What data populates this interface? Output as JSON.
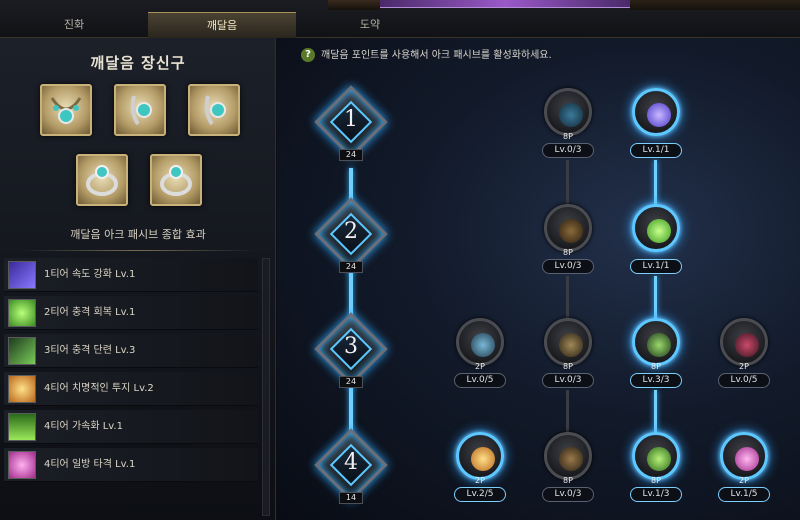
{
  "tabs": [
    {
      "label": "진화"
    },
    {
      "label": "깨달음"
    },
    {
      "label": "도약"
    }
  ],
  "left": {
    "title": "깨달음 장신구",
    "summary_title": "깨달음 아크 패시브 종합 효과",
    "effects": [
      {
        "label": "1티어 속도 강화 Lv.1",
        "icon": "speed-icon",
        "color": "#6a54d8"
      },
      {
        "label": "2티어 충격 회복 Lv.1",
        "icon": "recovery-icon",
        "color": "#5ac23a"
      },
      {
        "label": "3티어 충격 단련 Lv.3",
        "icon": "training-icon",
        "color": "#3e7a3a"
      },
      {
        "label": "4티어 치명적인 투지 Lv.2",
        "icon": "fighting-spirit-icon",
        "color": "#d8902a"
      },
      {
        "label": "4티어 가속화 Lv.1",
        "icon": "acceleration-icon",
        "color": "#58b838"
      },
      {
        "label": "4티어 일방 타격 Lv.1",
        "icon": "strike-icon",
        "color": "#d846b8"
      }
    ]
  },
  "right": {
    "hint": "깨달음 포인트를 사용해서 아크 패시브를 활성화하세요.",
    "tiers": [
      {
        "num": "1",
        "points": "24"
      },
      {
        "num": "2",
        "points": "24"
      },
      {
        "num": "3",
        "points": "24"
      },
      {
        "num": "4",
        "points": "14"
      }
    ],
    "nodes": {
      "t1a": {
        "points": "8P",
        "level": "Lv.0/3"
      },
      "t1b": {
        "points": "",
        "level": "Lv.1/1"
      },
      "t2a": {
        "points": "8P",
        "level": "Lv.0/3"
      },
      "t2b": {
        "points": "",
        "level": "Lv.1/1"
      },
      "t3a": {
        "points": "2P",
        "level": "Lv.0/5"
      },
      "t3b": {
        "points": "8P",
        "level": "Lv.0/3"
      },
      "t3c": {
        "points": "8P",
        "level": "Lv.3/3"
      },
      "t3d": {
        "points": "2P",
        "level": "Lv.0/5"
      },
      "t4a": {
        "points": "2P",
        "level": "Lv.2/5"
      },
      "t4b": {
        "points": "8P",
        "level": "Lv.0/3"
      },
      "t4c": {
        "points": "8P",
        "level": "Lv.1/3"
      },
      "t4d": {
        "points": "2P",
        "level": "Lv.1/5"
      }
    }
  },
  "colors": {
    "accent_blue": "#5dc8ff",
    "gold": "#c9b27a"
  }
}
